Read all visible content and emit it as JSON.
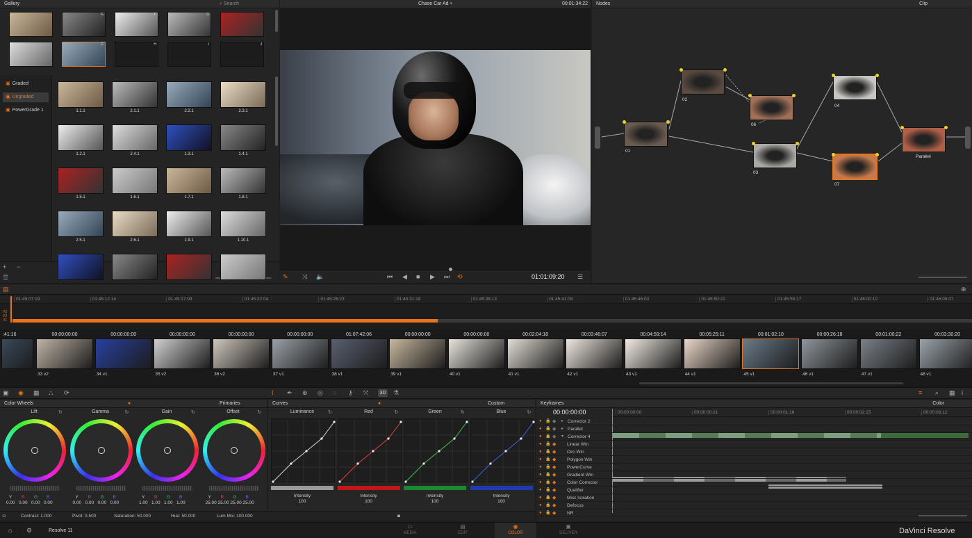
{
  "gallery": {
    "title": "Gallery",
    "search_placeholder": "Search",
    "stills": [
      {
        "id": "",
        "letter": ""
      },
      {
        "id": "",
        "letter": "E"
      },
      {
        "id": "",
        "letter": "F"
      },
      {
        "id": "",
        "letter": "G"
      },
      {
        "id": "",
        "letter": ""
      },
      {
        "id": "",
        "letter": ""
      },
      {
        "id": "",
        "letter": "C"
      },
      {
        "id": "",
        "letter": "H"
      },
      {
        "id": "",
        "letter": "I"
      },
      {
        "id": "",
        "letter": "J"
      }
    ],
    "albums": [
      "Graded",
      "Ungraded",
      "PowerGrade 1"
    ],
    "grid_labels": [
      "1.1.1",
      "2.1.1",
      "2.2.1",
      "2.3.1",
      "1.2.1",
      "2.4.1",
      "1.3.1",
      "1.4.1",
      "1.5.1",
      "1.6.1",
      "1.7.1",
      "1.8.1",
      "2.5.1",
      "2.6.1",
      "1.9.1",
      "1.10.1",
      "",
      "",
      "",
      ""
    ],
    "add_label": "+",
    "remove_label": "−"
  },
  "viewer": {
    "title": "Chase Car Ad",
    "timecode_top": "00:01:34:22",
    "timecode": "01:01:09:20"
  },
  "nodes": {
    "title": "Nodes",
    "mode": "Clip",
    "labels": [
      "01",
      "02",
      "06",
      "03",
      "04",
      "07",
      "Parallel"
    ]
  },
  "timeline": {
    "ruler": [
      "01:45:07:19",
      "01:45:12:14",
      "01:45:17:09",
      "01:45:22:04",
      "01:45:26:23",
      "01:45:31:18",
      "01:45:36:13",
      "01:45:41:08",
      "01:45:46:03",
      "01:45:50:22",
      "01:45:55:17",
      "01:46:00:12",
      "01:46:05:07"
    ],
    "tracks": [
      "V3",
      "V2",
      "V1"
    ]
  },
  "clips": [
    {
      "tc": ":41:16",
      "n": ""
    },
    {
      "tc": "00:00:00:00",
      "n": "33  v2"
    },
    {
      "tc": "00:00:00:00",
      "n": "34  v1"
    },
    {
      "tc": "00:00:00:00",
      "n": "35  v2"
    },
    {
      "tc": "00:00:00:00",
      "n": "36  v2"
    },
    {
      "tc": "00:00:00:00",
      "n": "37  v1"
    },
    {
      "tc": "01:07:42:06",
      "n": "38  v1"
    },
    {
      "tc": "00:00:00:00",
      "n": "39  v1"
    },
    {
      "tc": "00:00:00:00",
      "n": "40  v1"
    },
    {
      "tc": "00:02:04:18",
      "n": "41  v1"
    },
    {
      "tc": "00:03:46:07",
      "n": "42  v1"
    },
    {
      "tc": "00:04:59:14",
      "n": "43  v1"
    },
    {
      "tc": "00:05:25:11",
      "n": "44  v1"
    },
    {
      "tc": "00:01:02:10",
      "n": "45  v1"
    },
    {
      "tc": "00:00:26:18",
      "n": "46  v1"
    },
    {
      "tc": "00:01:00:22",
      "n": "47  v1"
    },
    {
      "tc": "00:03:30:20",
      "n": "48  v1"
    }
  ],
  "colorwheels": {
    "title": "Color Wheels",
    "mode": "Primaries",
    "wheels": [
      {
        "name": "Lift",
        "y": "0.00",
        "r": "0.00",
        "g": "0.00",
        "b": "0.00"
      },
      {
        "name": "Gamma",
        "y": "0.00",
        "r": "0.00",
        "g": "0.00",
        "b": "0.00"
      },
      {
        "name": "Gain",
        "y": "1.00",
        "r": "1.00",
        "g": "1.00",
        "b": "1.00"
      },
      {
        "name": "Offset",
        "y": "25.00",
        "r": "25.00",
        "g": "25.00",
        "b": "25.00"
      }
    ],
    "letters": [
      "Y",
      "R",
      "G",
      "B"
    ],
    "footer": {
      "contrast": "Contrast:  1.000",
      "pivot": "Pivot:  0.500",
      "saturation": "Saturation:  50.000",
      "hue": "Hue:  50.000",
      "lummix": "Lum Mix:  100.000"
    }
  },
  "curves": {
    "title": "Curves",
    "mode": "Custom",
    "channels": [
      {
        "name": "Luminance",
        "label": "Intensity",
        "value": "100",
        "color": "#d8d8d8",
        "bar": "#9a9a9a"
      },
      {
        "name": "Red",
        "label": "Intensity",
        "value": "100",
        "color": "#e04040",
        "bar": "#c01818"
      },
      {
        "name": "Green",
        "label": "Intensity",
        "value": "100",
        "color": "#40c060",
        "bar": "#1a8a30"
      },
      {
        "name": "Blue",
        "label": "Intensity",
        "value": "100",
        "color": "#4060e0",
        "bar": "#2038b0"
      }
    ]
  },
  "keyframes": {
    "title": "Keyframes",
    "mode": "Color",
    "timecode": "00:00:00:00",
    "ruler": [
      "00:00:00:00",
      "00:00:00:21",
      "00:00:01:18",
      "00:00:02:15",
      "00:00:03:12"
    ],
    "rows": [
      "Corrector 2",
      "Parallel",
      "Corrector 4",
      "Linear Win",
      "Circ Win",
      "Polygon Win",
      "PowerCurve",
      "Gradient Win",
      "Color Corrector",
      "Qualifier",
      "Misc Isolation",
      "Defocus",
      "NR"
    ]
  },
  "bottombar": {
    "project": "Resolve 11",
    "pages": [
      "MEDIA",
      "EDIT",
      "COLOR",
      "DELIVER"
    ],
    "brand": "DaVinci Resolve"
  },
  "colors": {
    "accent": "#e8741c",
    "bg": "#1e1e1e",
    "panel": "#242424"
  }
}
